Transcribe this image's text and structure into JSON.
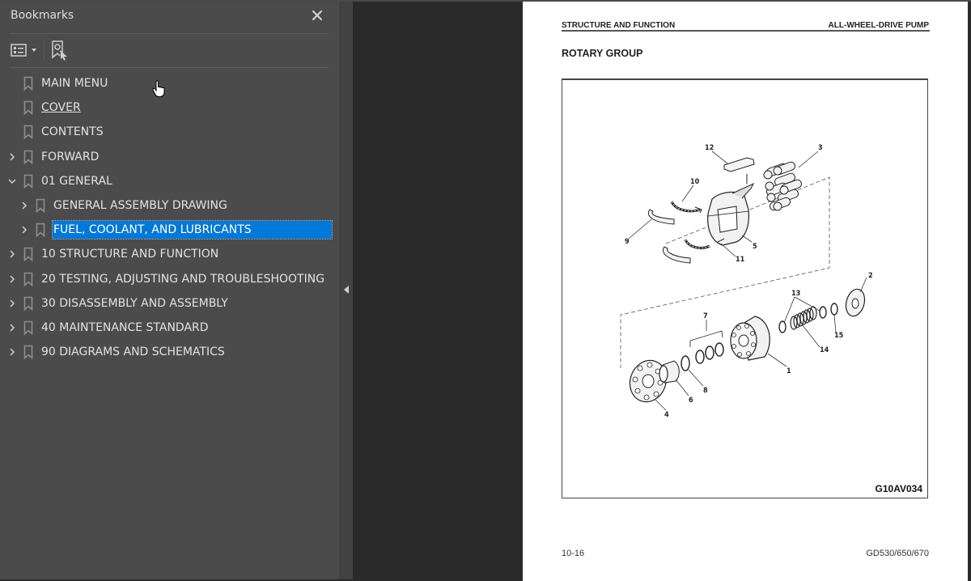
{
  "bookmarks_panel": {
    "title": "Bookmarks",
    "close_icon": "close-icon",
    "toolbar": {
      "options_icon": "list-options-icon",
      "add_bookmark_icon": "add-bookmark-icon"
    },
    "items": [
      {
        "label": "MAIN MENU",
        "level": 0,
        "expander": "none",
        "underline": false,
        "selected": false
      },
      {
        "label": "COVER",
        "level": 0,
        "expander": "none",
        "underline": true,
        "selected": false
      },
      {
        "label": "CONTENTS",
        "level": 0,
        "expander": "none",
        "underline": false,
        "selected": false
      },
      {
        "label": "FORWARD",
        "level": 0,
        "expander": "collapsed",
        "underline": false,
        "selected": false
      },
      {
        "label": "01 GENERAL",
        "level": 0,
        "expander": "expanded",
        "underline": false,
        "selected": false
      },
      {
        "label": "GENERAL ASSEMBLY DRAWING",
        "level": 1,
        "expander": "collapsed",
        "underline": false,
        "selected": false
      },
      {
        "label": "FUEL, COOLANT, AND LUBRICANTS",
        "level": 1,
        "expander": "collapsed",
        "underline": false,
        "selected": true
      },
      {
        "label": "10 STRUCTURE AND FUNCTION",
        "level": 0,
        "expander": "collapsed",
        "underline": false,
        "selected": false
      },
      {
        "label": "20 TESTING, ADJUSTING AND TROUBLESHOOTING",
        "level": 0,
        "expander": "collapsed",
        "underline": false,
        "selected": false
      },
      {
        "label": "30 DISASSEMBLY AND ASSEMBLY",
        "level": 0,
        "expander": "collapsed",
        "underline": false,
        "selected": false
      },
      {
        "label": "40 MAINTENANCE STANDARD",
        "level": 0,
        "expander": "collapsed",
        "underline": false,
        "selected": false
      },
      {
        "label": "90 DIAGRAMS AND SCHEMATICS",
        "level": 0,
        "expander": "collapsed",
        "underline": false,
        "selected": false
      }
    ]
  },
  "colors": {
    "panel_bg": "#4b4b4b",
    "viewer_bg": "#2a2a2a",
    "selection": "#0078d7",
    "page_bg": "#ffffff"
  },
  "document": {
    "header_left": "STRUCTURE AND FUNCTION",
    "header_right": "ALL-WHEEL-DRIVE PUMP",
    "section_title": "ROTARY GROUP",
    "figure_code": "G10AV034",
    "figure_callouts": [
      "1",
      "2",
      "3",
      "4",
      "5",
      "6",
      "7",
      "8",
      "9",
      "10",
      "11",
      "12",
      "13",
      "14",
      "15"
    ],
    "footer_left": "10-16",
    "footer_right": "GD530/650/670"
  }
}
